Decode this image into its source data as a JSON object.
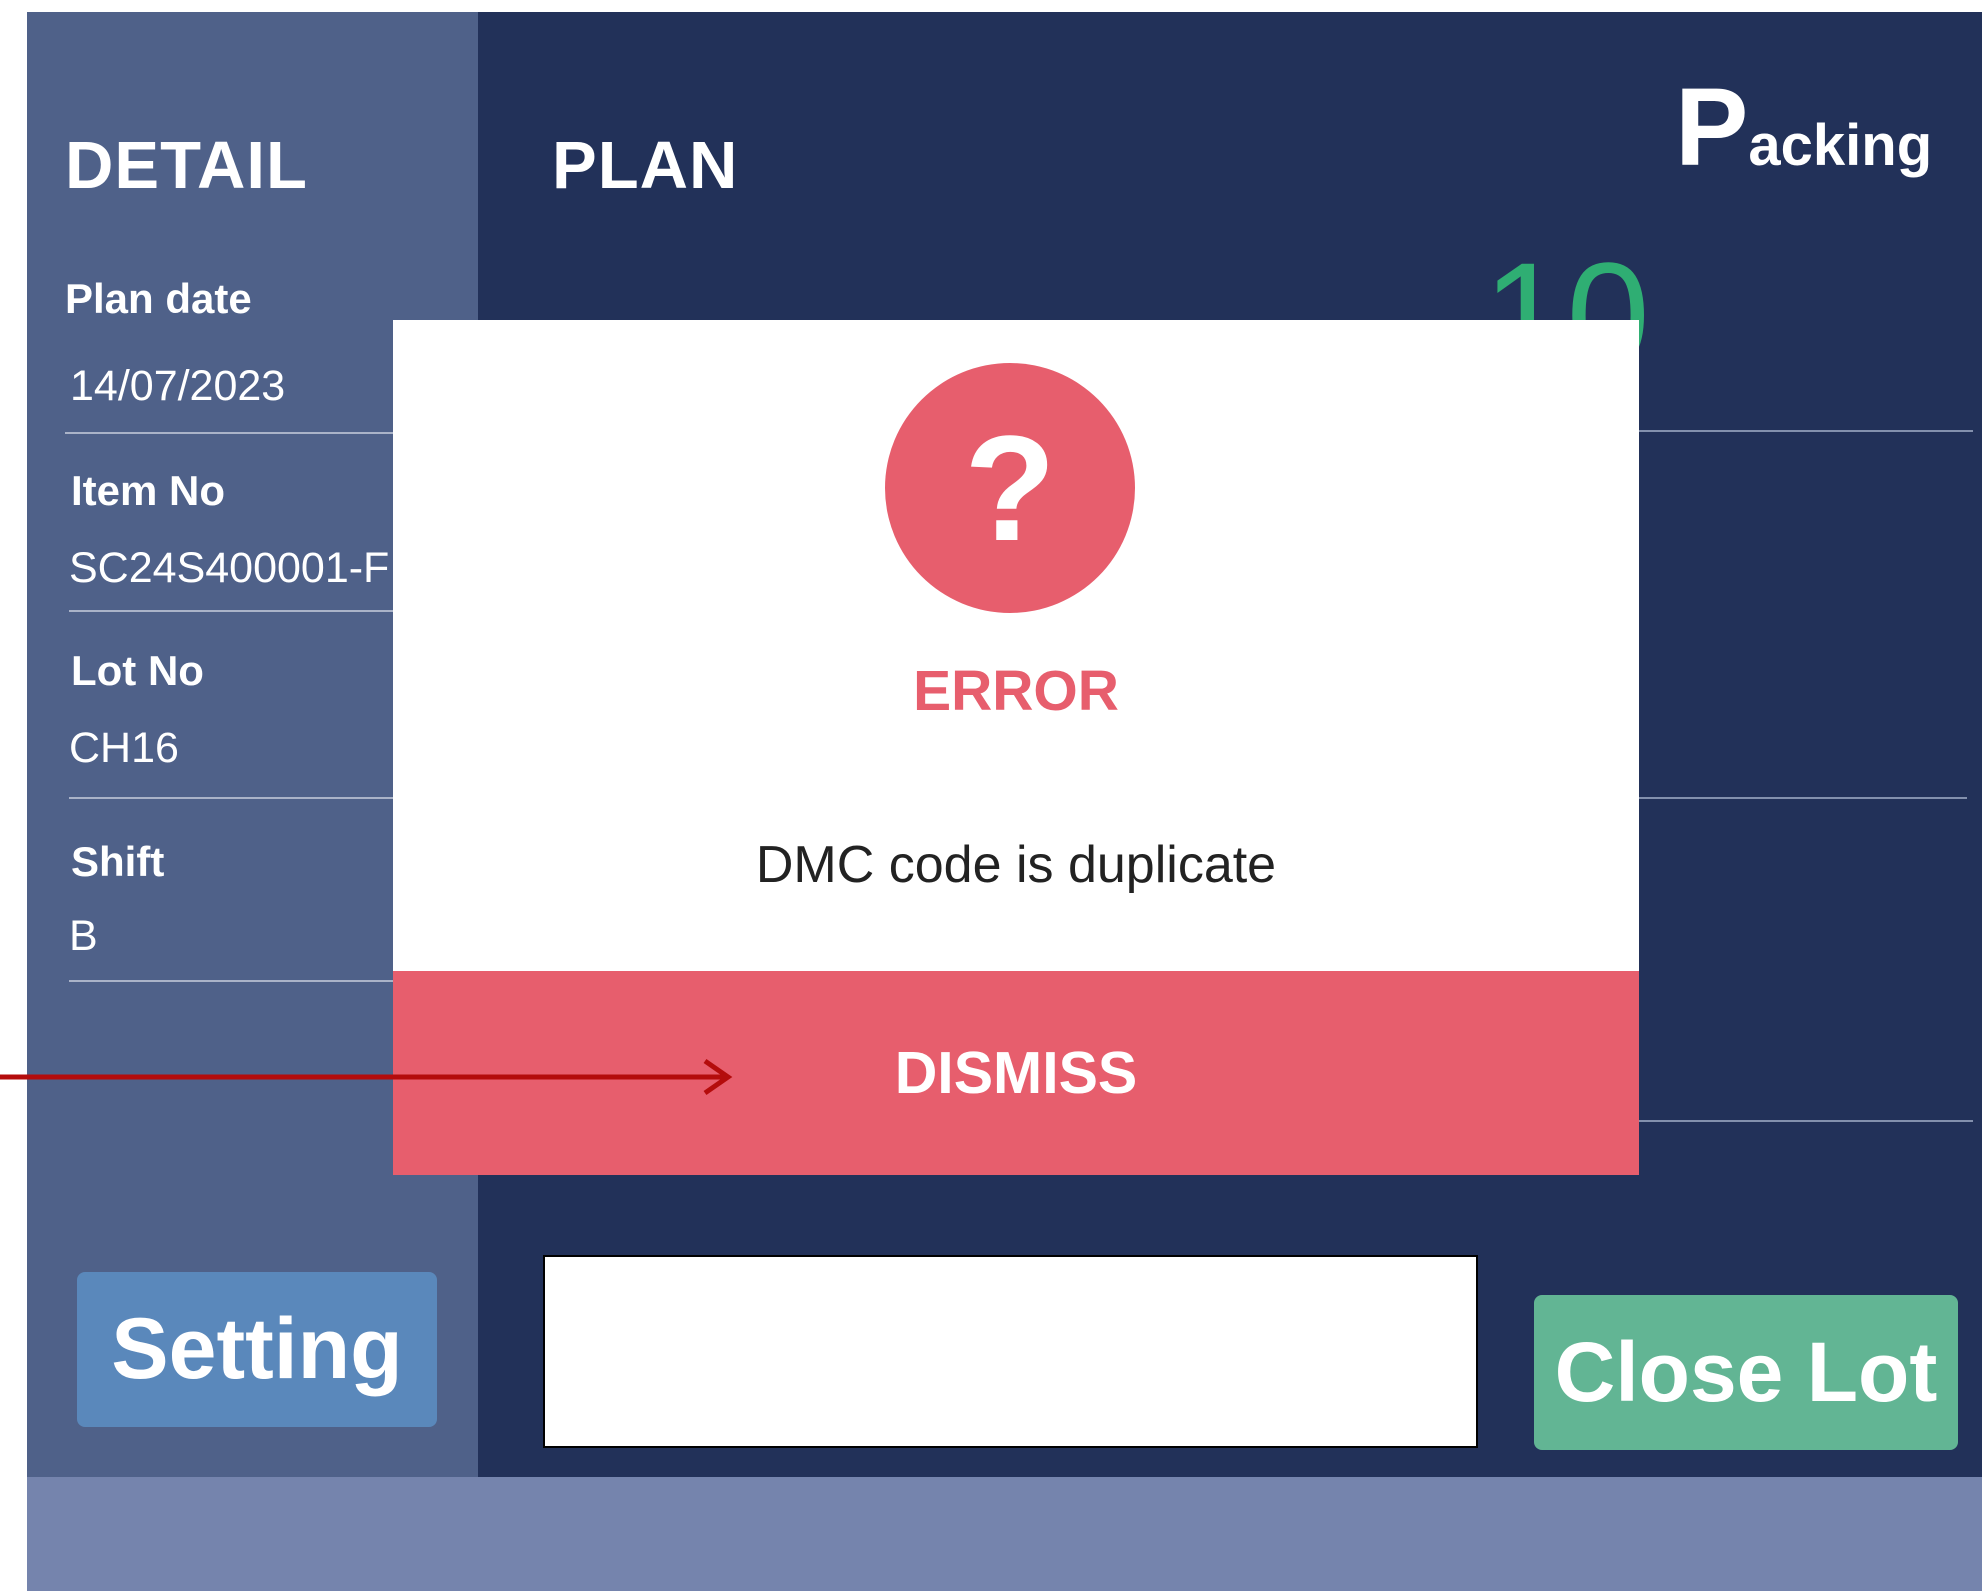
{
  "detail": {
    "title": "DETAIL",
    "fields": [
      {
        "label": "Plan date",
        "value": "14/07/2023"
      },
      {
        "label": "Item No",
        "value": "SC24S400001-F"
      },
      {
        "label": "Lot No",
        "value": "CH16"
      },
      {
        "label": "Shift",
        "value": "B"
      }
    ]
  },
  "plan": {
    "title": "PLAN",
    "brand_initial": "P",
    "brand_rest": "acking",
    "counter": "10"
  },
  "buttons": {
    "setting": "Setting",
    "close_lot": "Close Lot"
  },
  "scan_input": {
    "value": ""
  },
  "modal": {
    "icon": "?",
    "title": "ERROR",
    "message": "DMC code is duplicate",
    "dismiss": "DISMISS"
  },
  "colors": {
    "detail_bg": "#4f6189",
    "plan_bg": "#223159",
    "bottom_bar": "#7584ad",
    "error": "#e75e6d",
    "setting_button": "#5a88bb",
    "close_lot_button": "#62b594",
    "counter": "#2fae73",
    "annotation_arrow": "#b40c0c"
  }
}
